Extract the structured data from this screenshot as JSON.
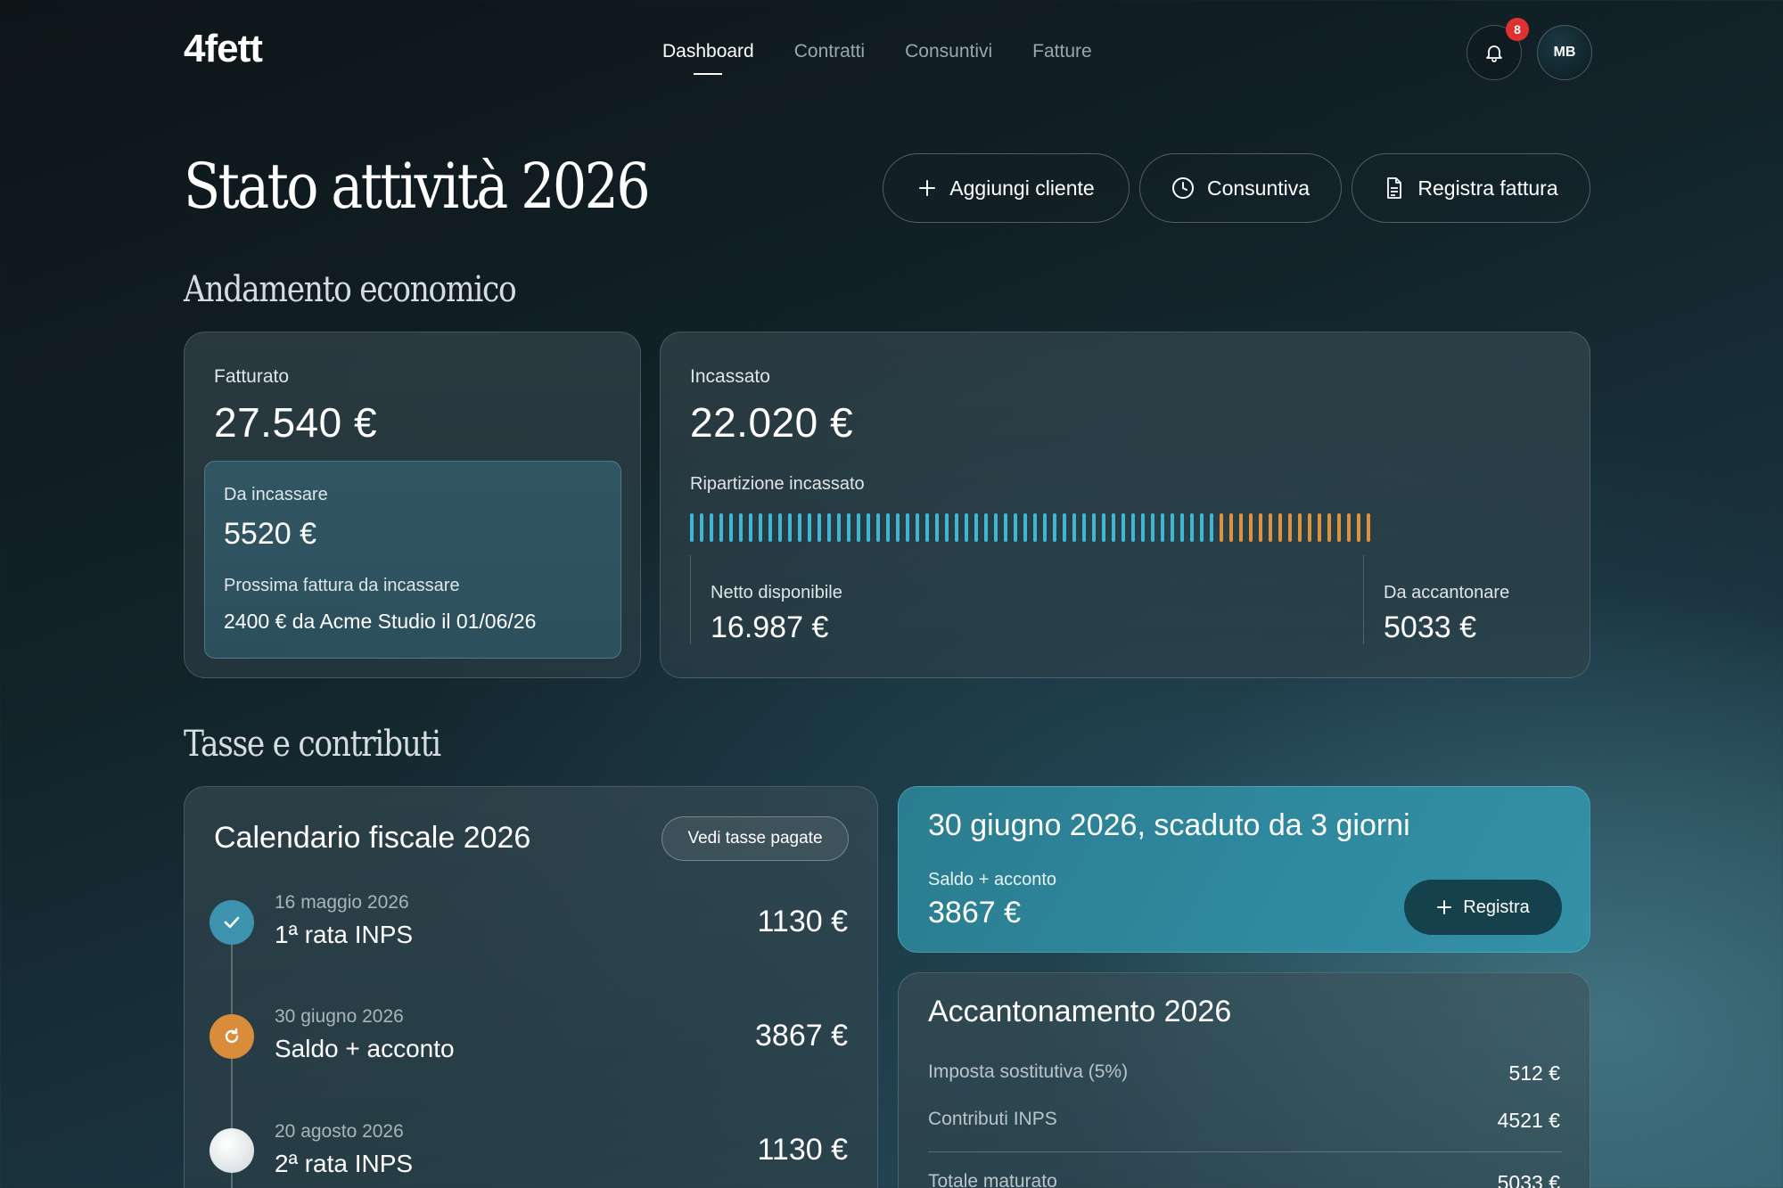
{
  "nav": {
    "logo": "4fett",
    "items": [
      {
        "label": "Dashboard",
        "active": true
      },
      {
        "label": "Contratti"
      },
      {
        "label": "Consuntivi"
      },
      {
        "label": "Fatture"
      }
    ],
    "notification_count": "8",
    "avatar_initials": "MB"
  },
  "header": {
    "title": "Stato attività 2026",
    "actions": {
      "add_client": "Aggiungi cliente",
      "consuntiva": "Consuntiva",
      "register_invoice": "Registra fattura"
    }
  },
  "economico": {
    "section_title": "Andamento economico",
    "fatturato": {
      "label": "Fatturato",
      "value": "27.540 €",
      "da_incassare": {
        "label": "Da incassare",
        "value": "5520 €",
        "next_label": "Prossima fattura da incassare",
        "next_value": "2400 € da Acme Studio il 01/06/26"
      }
    },
    "incassato": {
      "label": "Incassato",
      "value": "22.020 €",
      "ripartizione_label": "Ripartizione incassato",
      "netto_label": "Netto disponibile",
      "netto_value": "16.987 €",
      "accantonare_label": "Da accantonare",
      "accantonare_value": "5033 €",
      "netto_share": 0.7714,
      "colors": {
        "netto": "#3fb6d3",
        "accantonare": "#e0913e"
      }
    }
  },
  "tasse": {
    "section_title": "Tasse e contributi",
    "calendario": {
      "title": "Calendario fiscale 2026",
      "button": "Vedi tasse pagate",
      "items": [
        {
          "date": "16 maggio 2026",
          "name": "1ª rata INPS",
          "amount": "1130 €",
          "status": "paid"
        },
        {
          "date": "30 giugno 2026",
          "name": "Saldo + acconto",
          "amount": "3867 €",
          "status": "overdue"
        },
        {
          "date": "20 agosto 2026",
          "name": "2ª rata INPS",
          "amount": "1130 €",
          "status": "upcoming"
        }
      ]
    },
    "scadenza": {
      "title": "30 giugno 2026, scaduto da 3 giorni",
      "label": "Saldo + acconto",
      "value": "3867 €",
      "button": "Registra"
    },
    "accantonamento": {
      "title": "Accantonamento 2026",
      "rows": [
        {
          "label": "Imposta sostitutiva (5%)",
          "value": "512 €"
        },
        {
          "label": "Contributi INPS",
          "value": "4521 €"
        }
      ],
      "total_label": "Totale maturato",
      "total_value": "5033 €"
    }
  }
}
